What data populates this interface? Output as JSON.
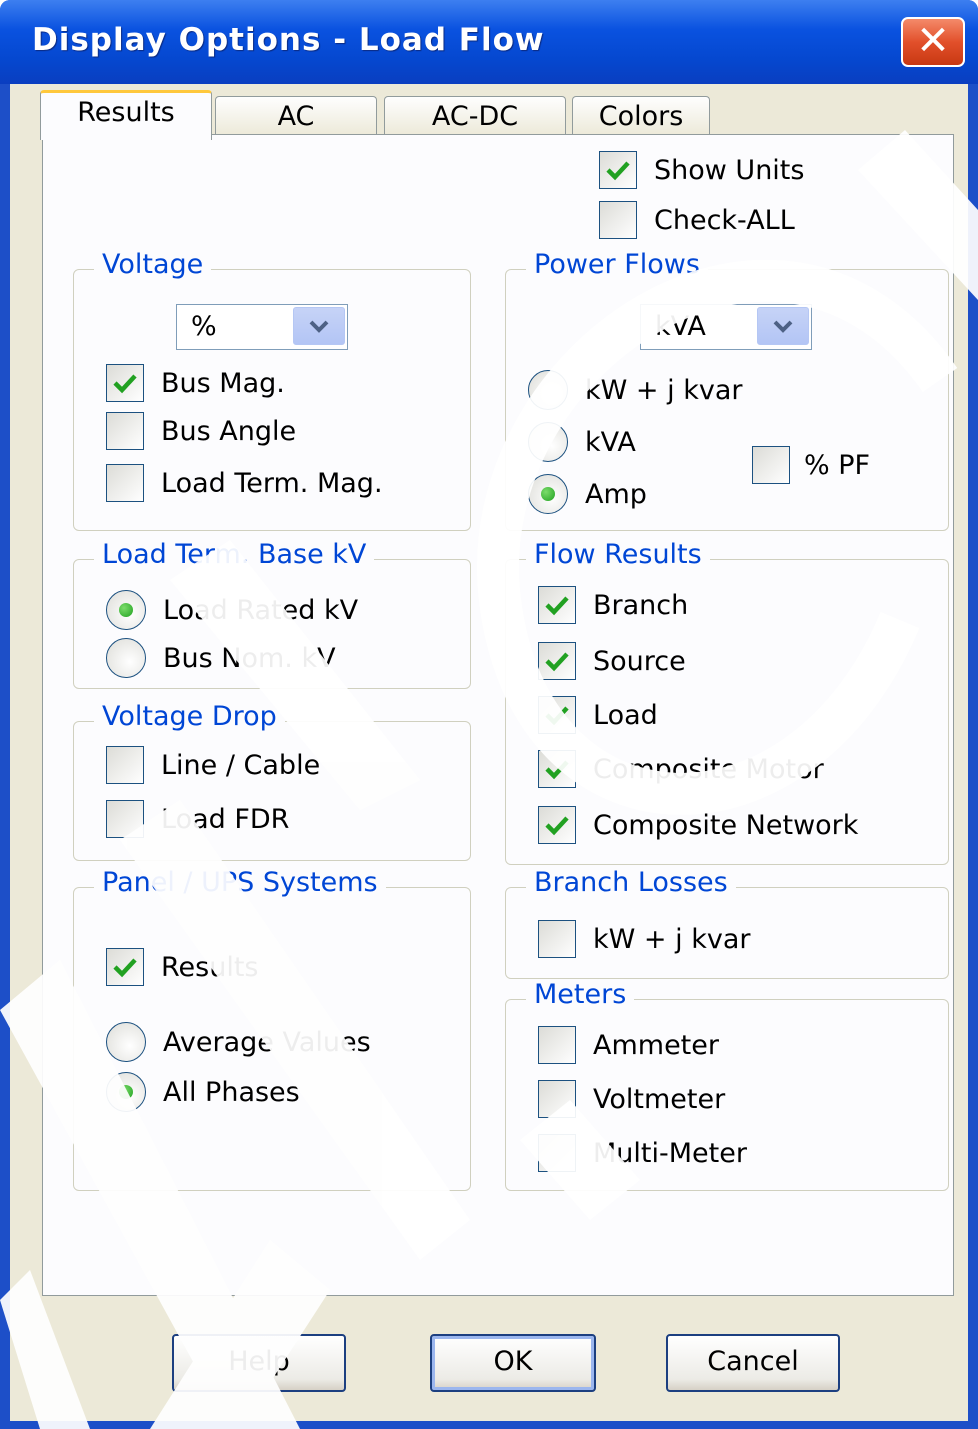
{
  "window": {
    "title": "Display Options - Load Flow",
    "close_glyph": "✕"
  },
  "tabs": [
    {
      "label": "Results",
      "active": true
    },
    {
      "label": "AC",
      "active": false
    },
    {
      "label": "AC-DC",
      "active": false
    },
    {
      "label": "Colors",
      "active": false
    }
  ],
  "top_options": {
    "show_units": {
      "label": "Show Units",
      "checked": true
    },
    "check_all": {
      "label": "Check-ALL",
      "checked": false
    }
  },
  "voltage": {
    "legend": "Voltage",
    "unit_select": "%",
    "bus_mag": {
      "label": "Bus Mag.",
      "checked": true
    },
    "bus_angle": {
      "label": "Bus Angle",
      "checked": false
    },
    "load_term_mag": {
      "label": "Load Term. Mag.",
      "checked": false
    }
  },
  "power_flows": {
    "legend": "Power Flows",
    "unit_select": "kVA",
    "kw_kvar": {
      "label": "kW + j kvar",
      "selected": false
    },
    "kva": {
      "label": "kVA",
      "selected": false
    },
    "amp": {
      "label": "Amp",
      "selected": true
    },
    "pf": {
      "label": "% PF",
      "checked": false
    }
  },
  "load_term_base_kv": {
    "legend": "Load Term. Base kV",
    "load_rated_kv": {
      "label": "Load Rated kV",
      "selected": true
    },
    "bus_nom_kv": {
      "label": "Bus Nom. kV",
      "selected": false
    }
  },
  "flow_results": {
    "legend": "Flow Results",
    "branch": {
      "label": "Branch",
      "checked": true
    },
    "source": {
      "label": "Source",
      "checked": true
    },
    "load": {
      "label": "Load",
      "checked": true
    },
    "composite_motor": {
      "label": "Composite Motor",
      "checked": true
    },
    "composite_network": {
      "label": "Composite Network",
      "checked": true
    }
  },
  "voltage_drop": {
    "legend": "Voltage Drop",
    "line_cable": {
      "label": "Line / Cable",
      "checked": false
    },
    "load_fdr": {
      "label": "Load FDR",
      "checked": false
    }
  },
  "branch_losses": {
    "legend": "Branch Losses",
    "kw_kvar": {
      "label": "kW + j kvar",
      "checked": false
    }
  },
  "panel_ups": {
    "legend": "Panel / UPS Systems",
    "results": {
      "label": "Results",
      "checked": true
    },
    "average_values": {
      "label": "Average Values",
      "selected": false
    },
    "all_phases": {
      "label": "All Phases",
      "selected": true
    }
  },
  "meters": {
    "legend": "Meters",
    "ammeter": {
      "label": "Ammeter",
      "checked": false
    },
    "voltmeter": {
      "label": "Voltmeter",
      "checked": false
    },
    "multi_meter": {
      "label": "Multi-Meter",
      "checked": false
    }
  },
  "buttons": {
    "help": "Help",
    "ok": "OK",
    "cancel": "Cancel"
  },
  "colors": {
    "accent_blue": "#0046d5",
    "title_blue": "#0a52e0",
    "check_green": "#21a121",
    "dialog_face": "#ece9d8"
  }
}
